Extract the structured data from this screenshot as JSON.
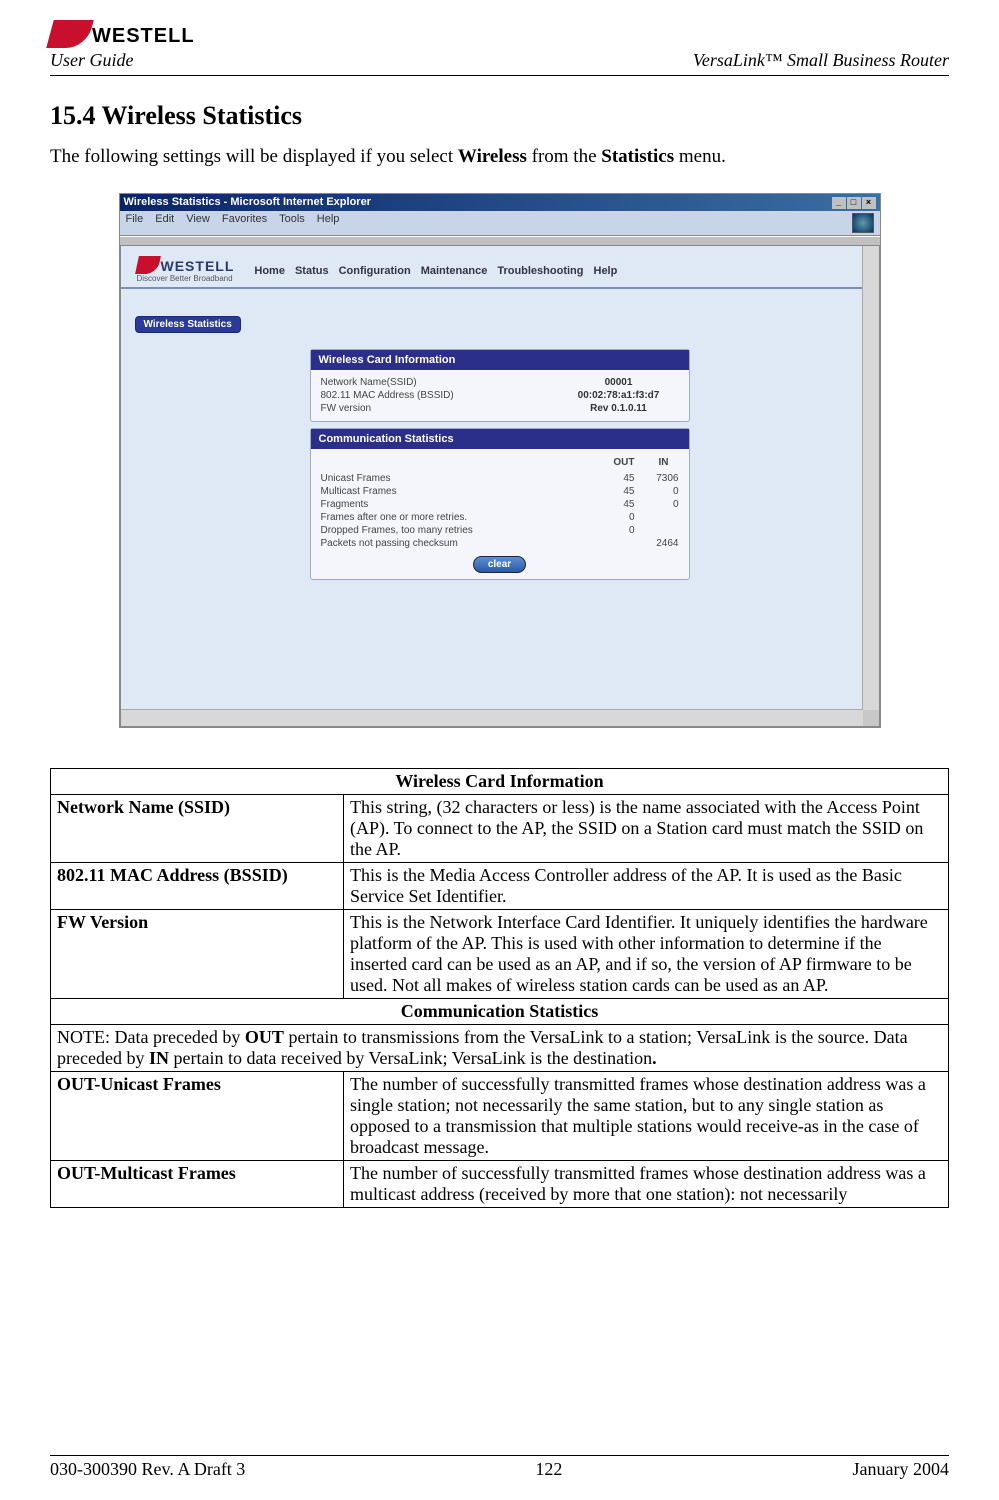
{
  "header": {
    "brand": "WESTELL",
    "user_guide": "User Guide",
    "product": "VersaLink™  Small Business Router"
  },
  "section": {
    "heading": "15.4 Wireless Statistics",
    "intro_pre": "The following settings will be displayed if you select ",
    "intro_b1": "Wireless",
    "intro_mid": " from the ",
    "intro_b2": "Statistics",
    "intro_post": " menu."
  },
  "screenshot": {
    "title": "Wireless Statistics - Microsoft Internet Explorer",
    "menu": [
      "File",
      "Edit",
      "View",
      "Favorites",
      "Tools",
      "Help"
    ],
    "app_brand": "WESTELL",
    "app_tagline": "Discover Better Broadband",
    "nav": [
      "Home",
      "Status",
      "Configuration",
      "Maintenance",
      "Troubleshooting",
      "Help"
    ],
    "tab": "Wireless Statistics",
    "panel1": {
      "title": "Wireless Card Information",
      "rows": [
        {
          "label": "Network Name(SSID)",
          "value": "00001"
        },
        {
          "label": "802.11 MAC Address (BSSID)",
          "value": "00:02:78:a1:f3:d7"
        },
        {
          "label": "FW version",
          "value": "Rev 0.1.0.11"
        }
      ]
    },
    "panel2": {
      "title": "Communication Statistics",
      "head_out": "OUT",
      "head_in": "IN",
      "rows": [
        {
          "label": "Unicast Frames",
          "out": "45",
          "in": "7306"
        },
        {
          "label": "Multicast Frames",
          "out": "45",
          "in": "0"
        },
        {
          "label": "Fragments",
          "out": "45",
          "in": "0"
        },
        {
          "label": "Frames after one or more retries.",
          "out": "0",
          "in": ""
        },
        {
          "label": "Dropped Frames, too many retries",
          "out": "0",
          "in": ""
        },
        {
          "label": "Packets not passing checksum",
          "out": "",
          "in": "2464"
        }
      ],
      "clear": "clear"
    }
  },
  "table": {
    "section1": "Wireless Card Information",
    "r1": {
      "label": "Network Name (SSID)",
      "desc": "This string, (32 characters or less) is the name associated with the Access Point (AP). To connect to the AP, the SSID on a Station card must match the SSID on the AP."
    },
    "r2": {
      "label": "802.11 MAC Address (BSSID)",
      "desc": "This is the Media Access Controller address of the AP. It is used as the Basic Service Set Identifier."
    },
    "r3": {
      "label": "FW Version",
      "desc": "This is the Network Interface Card Identifier. It uniquely identifies the hardware platform of the AP. This is used with other information to determine if the inserted card can be used as an AP, and if so, the version of AP firmware to be used. Not all makes of wireless station cards can be used as an AP."
    },
    "section2": "Communication Statistics",
    "note_pre": "NOTE: Data preceded by ",
    "note_b1": "OUT",
    "note_mid": " pertain to transmissions from the VersaLink to a station; VersaLink is the source. Data preceded by ",
    "note_b2": "IN",
    "note_post": " pertain to data received by VersaLink; VersaLink is the destination",
    "note_dot": ".",
    "r4": {
      "label": "OUT-Unicast Frames",
      "desc": "The number of successfully transmitted frames whose destination address was a single station; not necessarily the same station, but to any single station as opposed to a transmission that multiple stations would receive-as in the case of broadcast message."
    },
    "r5": {
      "label": "OUT-Multicast Frames",
      "desc": "The number of successfully transmitted frames whose destination address was a multicast address (received by more that one station): not necessarily"
    }
  },
  "footer": {
    "left": "030-300390 Rev. A Draft 3",
    "center": "122",
    "right": "January 2004"
  }
}
